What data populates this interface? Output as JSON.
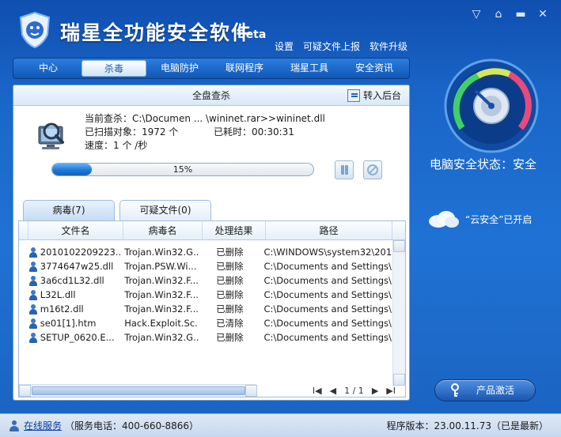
{
  "app": {
    "title": "瑞星全功能安全软件",
    "beta": "Beta"
  },
  "top_links": [
    "设置",
    "可疑文件上报",
    "软件升级"
  ],
  "window_controls": [
    "menu-icon",
    "skin-icon",
    "minimize-icon",
    "close-icon"
  ],
  "nav": {
    "tabs": [
      "中心",
      "杀毒",
      "电脑防护",
      "联网程序",
      "瑞星工具",
      "安全资讯"
    ],
    "active": "杀毒"
  },
  "scan": {
    "title": "全盘查杀",
    "to_background": "转入后台",
    "current_label": "当前查杀：",
    "current_value": "C:\\Documen ... \\wininet.rar>>wininet.dll",
    "scanned_label": "已扫描对象：",
    "scanned_value": "1972 个",
    "elapsed_label": "已耗时：",
    "elapsed_value": "00:30:31",
    "speed_label": "速度：",
    "speed_value": "1 个 /秒",
    "progress_percent": 15,
    "progress_text": "15%"
  },
  "subtabs": [
    {
      "label": "病毒(7)",
      "active": true
    },
    {
      "label": "可疑文件(0)",
      "active": false
    }
  ],
  "table": {
    "headers": [
      "文件名",
      "病毒名",
      "处理结果",
      "路径"
    ],
    "rows": [
      {
        "name": "2010102209223...",
        "virus": "Trojan.Win32.G...",
        "result": "已删除",
        "path": "C:\\WINDOWS\\system32\\201..."
      },
      {
        "name": "3774647w25.dll",
        "virus": "Trojan.PSW.Wi...",
        "result": "已删除",
        "path": "C:\\Documents and Settings\\..."
      },
      {
        "name": "3a6cd1L32.dll",
        "virus": "Trojan.Win32.F...",
        "result": "已删除",
        "path": "C:\\Documents and Settings\\..."
      },
      {
        "name": "L32L.dll",
        "virus": "Trojan.Win32.F...",
        "result": "已删除",
        "path": "C:\\Documents and Settings\\..."
      },
      {
        "name": "m16t2.dll",
        "virus": "Trojan.Win32.F...",
        "result": "已删除",
        "path": "C:\\Documents and Settings\\..."
      },
      {
        "name": "se01[1].htm",
        "virus": "Hack.Exploit.Sc...",
        "result": "已清除",
        "path": "C:\\Documents and Settings\\..."
      },
      {
        "name": "SETUP_0620.E...",
        "virus": "Trojan.Win32.G...",
        "result": "已删除",
        "path": "C:\\Documents and Settings\\..."
      }
    ]
  },
  "pager": {
    "first": "I◀",
    "prev": "◀",
    "page_text": "1 / 1",
    "next": "▶",
    "last": "▶I"
  },
  "status": {
    "security_state": "电脑安全状态：安全",
    "cloud_text": "“云安全”已开启"
  },
  "activate_button": "产品激活",
  "footer": {
    "online_service": "在线服务",
    "phone": "（服务电话：400-660-8866）",
    "version": "程序版本：23.00.11.73（已是最新）"
  },
  "colors": {
    "brand_blue": "#1a66c8",
    "progress_blue": "#1f78d6",
    "panel_border": "#6f9fd5"
  }
}
